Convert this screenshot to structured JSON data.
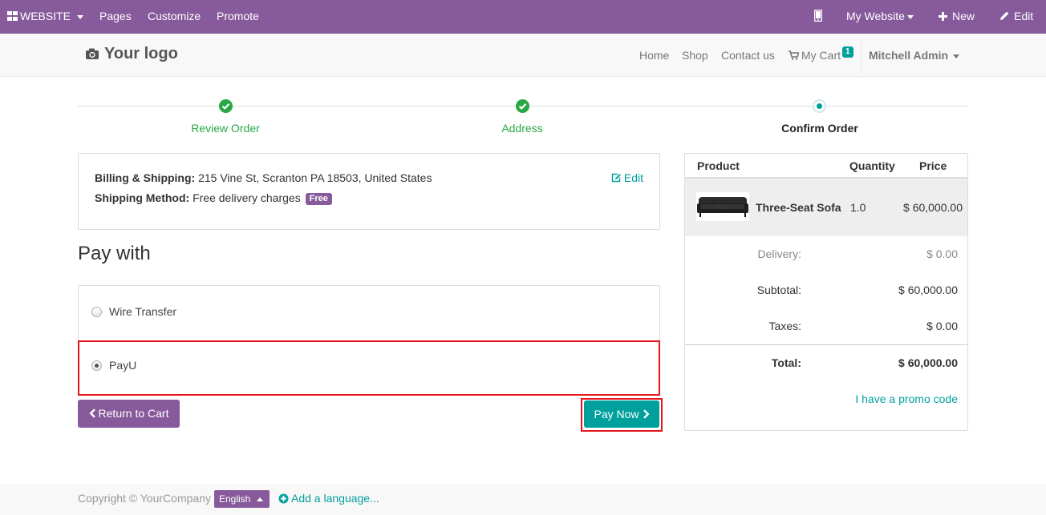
{
  "topbar": {
    "website_label": "WEBSITE",
    "pages": "Pages",
    "customize": "Customize",
    "promote": "Promote",
    "my_website": "My Website",
    "new_label": "New",
    "edit_label": "Edit"
  },
  "header": {
    "logo_text": "Your logo",
    "nav": [
      "Home",
      "Shop",
      "Contact us"
    ],
    "cart_label": "My Cart",
    "cart_count": "1",
    "user": "Mitchell Admin"
  },
  "wizard": {
    "steps": [
      {
        "label": "Review Order",
        "state": "done"
      },
      {
        "label": "Address",
        "state": "done"
      },
      {
        "label": "Confirm Order",
        "state": "current"
      }
    ]
  },
  "billing": {
    "billing_label": "Billing & Shipping:",
    "billing_value": "215 Vine St, Scranton PA 18503, United States",
    "shipping_label": "Shipping Method:",
    "shipping_value": "Free delivery charges",
    "free_badge": "Free",
    "edit": "Edit"
  },
  "payment": {
    "heading": "Pay with",
    "methods": [
      {
        "label": "Wire Transfer",
        "checked": false
      },
      {
        "label": "PayU",
        "checked": true
      }
    ],
    "return_label": "Return to Cart",
    "pay_label": "Pay Now"
  },
  "summary": {
    "headers": {
      "product": "Product",
      "quantity": "Quantity",
      "price": "Price"
    },
    "line": {
      "name": "Three-Seat Sofa",
      "qty": "1.0",
      "price": "$ 60,000.00"
    },
    "delivery_label": "Delivery:",
    "delivery_value": "$ 0.00",
    "subtotal_label": "Subtotal:",
    "subtotal_value": "$ 60,000.00",
    "taxes_label": "Taxes:",
    "taxes_value": "$ 0.00",
    "total_label": "Total:",
    "total_value": "$ 60,000.00",
    "promo": "I have a promo code"
  },
  "footer": {
    "copyright": "Copyright © YourCompany",
    "language": "English",
    "add_language": "Add a language..."
  },
  "colors": {
    "brand": "#875a9b",
    "accent": "#00a09d",
    "success": "#28a745",
    "highlight": "#e4161c"
  }
}
